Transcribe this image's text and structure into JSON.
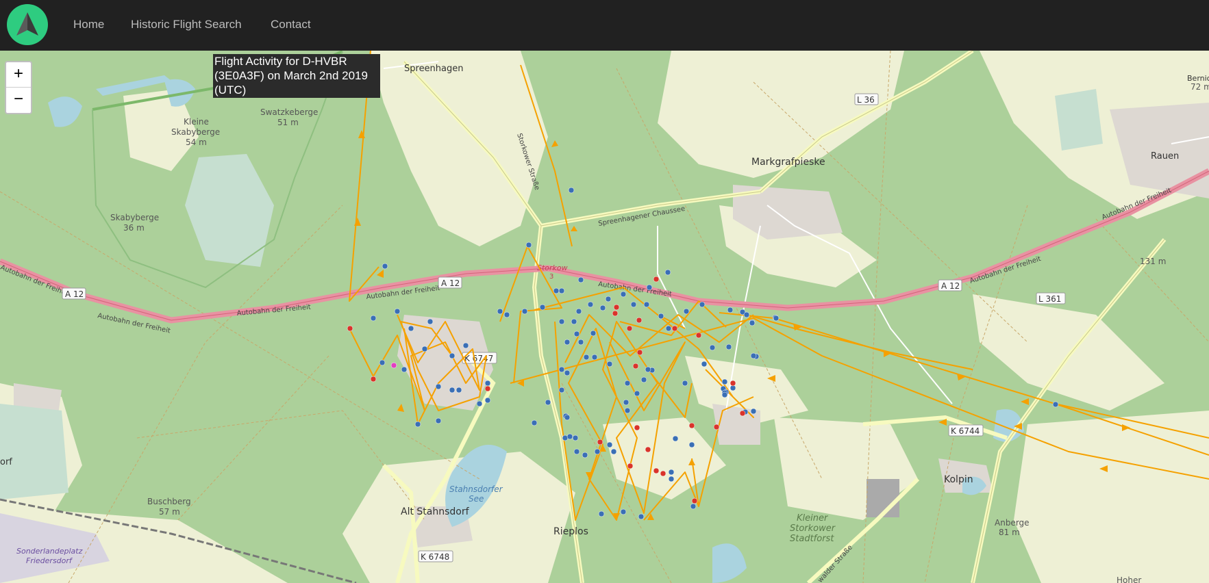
{
  "nav": {
    "home": "Home",
    "search": "Historic Flight Search",
    "contact": "Contact"
  },
  "title": {
    "line1": "Flight Activity for D-HVBR",
    "line2": "(3E0A3F) on March 2nd 2019",
    "line3": "(UTC)"
  },
  "zoom": {
    "in": "+",
    "out": "−"
  },
  "map": {
    "places": {
      "spreenhagen": "Spreenhagen",
      "markgrafpieske": "Markgrafpieske",
      "rauen": "Rauen",
      "bernichen": "Bernichen",
      "bernichen_elev": "72 m",
      "kolpin": "Kolpin",
      "rieplos": "Rieplos",
      "alt_stahnsdorf": "Alt Stahnsdorf",
      "storkow": "Storkow",
      "storkow_num": "3",
      "kleine_skabyberge": "Kleine",
      "kleine_skabyberge2": "Skabyberge",
      "kleine_elev": "54 m",
      "swatzkeberge": "Swatzkeberge",
      "swatzkeberge_elev": "51 m",
      "skabyberge": "Skabyberge",
      "skabyberge_elev": "36 m",
      "buschberg": "Buschberg",
      "buschberg_elev": "57 m",
      "anberge": "Anberge",
      "anberge_elev": "81 m",
      "elev131": "131 m",
      "sonderlande1": "Sonderlandeplatz",
      "sonderlande2": "Friedersdorf",
      "orf": "orf",
      "hoher": "Hoher"
    },
    "water": {
      "lake1": "Stahnsdorfer",
      "lake2": "See"
    },
    "forest": {
      "line1": "Kleiner",
      "line2": "Storkower",
      "line3": "Stadtforst"
    },
    "shields": {
      "a12_left": "A 12",
      "a12_mid": "A 12",
      "a12_right": "A 12",
      "l36": "L 36",
      "l361": "L 361",
      "k6747": "K 6747",
      "k6744": "K 6744",
      "k6748": "K 6748"
    },
    "roads": {
      "autobahn": "Autobahn der Freiheit",
      "storkower": "Storkower Straße",
      "chaussee": "Spreenhagener Chaussee",
      "walder": "walder Straße"
    }
  },
  "colors": {
    "track": "#f5a100",
    "point_blue": "#3a6fb5",
    "point_red": "#d9342b",
    "forest": "#acd09a",
    "field": "#eef0d5",
    "autobahn": "#e892a2",
    "water": "#aad3df"
  }
}
